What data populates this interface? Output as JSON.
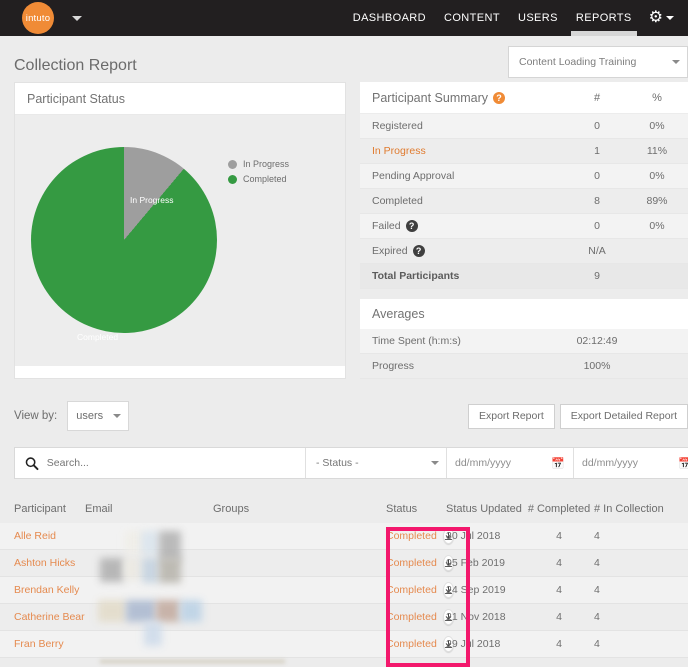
{
  "topnav": {
    "logo_text": "intuto",
    "items": [
      {
        "label": "DASHBOARD",
        "active": false
      },
      {
        "label": "CONTENT",
        "active": false
      },
      {
        "label": "USERS",
        "active": false
      },
      {
        "label": "REPORTS",
        "active": true
      }
    ],
    "gear_icon": "gear-icon"
  },
  "header": {
    "title": "Collection Report",
    "collection_selected": "Content Loading Training"
  },
  "pie_panel": {
    "title": "Participant Status",
    "slice_labels": {
      "in_progress": "In Progress",
      "completed": "Completed"
    },
    "legend": [
      {
        "label": "In Progress",
        "color": "#9e9e9e"
      },
      {
        "label": "Completed",
        "color": "#359a42"
      }
    ]
  },
  "chart_data": {
    "type": "pie",
    "title": "Participant Status",
    "categories": [
      "In Progress",
      "Completed"
    ],
    "values": [
      1,
      8
    ],
    "percentages": [
      11,
      89
    ],
    "colors": [
      "#9e9e9e",
      "#359a42"
    ],
    "legend_position": "right",
    "labels_inside": [
      "In Progress",
      "Completed"
    ]
  },
  "summary": {
    "title": "Participant Summary",
    "help_icon": "help-icon",
    "columns": [
      "#",
      "%"
    ],
    "rows": [
      {
        "label": "Registered",
        "count": "0",
        "pct": "0%",
        "highlight": false,
        "help": false
      },
      {
        "label": "In Progress",
        "count": "1",
        "pct": "11%",
        "highlight": true,
        "help": false
      },
      {
        "label": "Pending Approval",
        "count": "0",
        "pct": "0%",
        "highlight": false,
        "help": false
      },
      {
        "label": "Completed",
        "count": "8",
        "pct": "89%",
        "highlight": false,
        "help": false
      },
      {
        "label": "Failed",
        "count": "0",
        "pct": "0%",
        "highlight": false,
        "help": true
      },
      {
        "label": "Expired",
        "count": "N/A",
        "pct": "",
        "highlight": false,
        "help": true
      }
    ],
    "total_label": "Total Participants",
    "total_count": "9"
  },
  "averages": {
    "title": "Averages",
    "rows": [
      {
        "label": "Time Spent (h:m:s)",
        "value": "02:12:49"
      },
      {
        "label": "Progress",
        "value": "100%"
      }
    ]
  },
  "viewby": {
    "label": "View by:",
    "selected": "users",
    "export_report": "Export Report",
    "export_detailed_report": "Export Detailed Report"
  },
  "filters": {
    "search_placeholder": "Search...",
    "search_value": "",
    "search_icon": "search-icon",
    "status_selected": "- Status -",
    "date_from_placeholder": "dd/mm/yyyy",
    "date_to_placeholder": "dd/mm/yyyy",
    "calendar_icon": "calendar-icon"
  },
  "table": {
    "columns": [
      "Participant",
      "Email",
      "Groups",
      "Status",
      "Status Updated",
      "# Completed",
      "# In Collection"
    ],
    "rows": [
      {
        "participant": "Alle Reid",
        "email": "",
        "groups": "",
        "status": "Completed",
        "updated": "30 Jul 2018",
        "completed": "4",
        "in_collection": "4"
      },
      {
        "participant": "Ashton Hicks",
        "email": "",
        "groups": "",
        "status": "Completed",
        "updated": "05 Feb 2019",
        "completed": "4",
        "in_collection": "4"
      },
      {
        "participant": "Brendan Kelly",
        "email": "",
        "groups": "",
        "status": "Completed",
        "updated": "24 Sep 2019",
        "completed": "4",
        "in_collection": "4"
      },
      {
        "participant": "Catherine Bear",
        "email": "",
        "groups": "",
        "status": "Completed",
        "updated": "21 Nov 2018",
        "completed": "4",
        "in_collection": "4"
      },
      {
        "participant": "Fran Berry",
        "email": "",
        "groups": "",
        "status": "Completed",
        "updated": "29 Jul 2018",
        "completed": "4",
        "in_collection": "4"
      }
    ],
    "download_icon": "download-icon"
  },
  "annotation": {
    "highlight_color": "#f3186c"
  }
}
